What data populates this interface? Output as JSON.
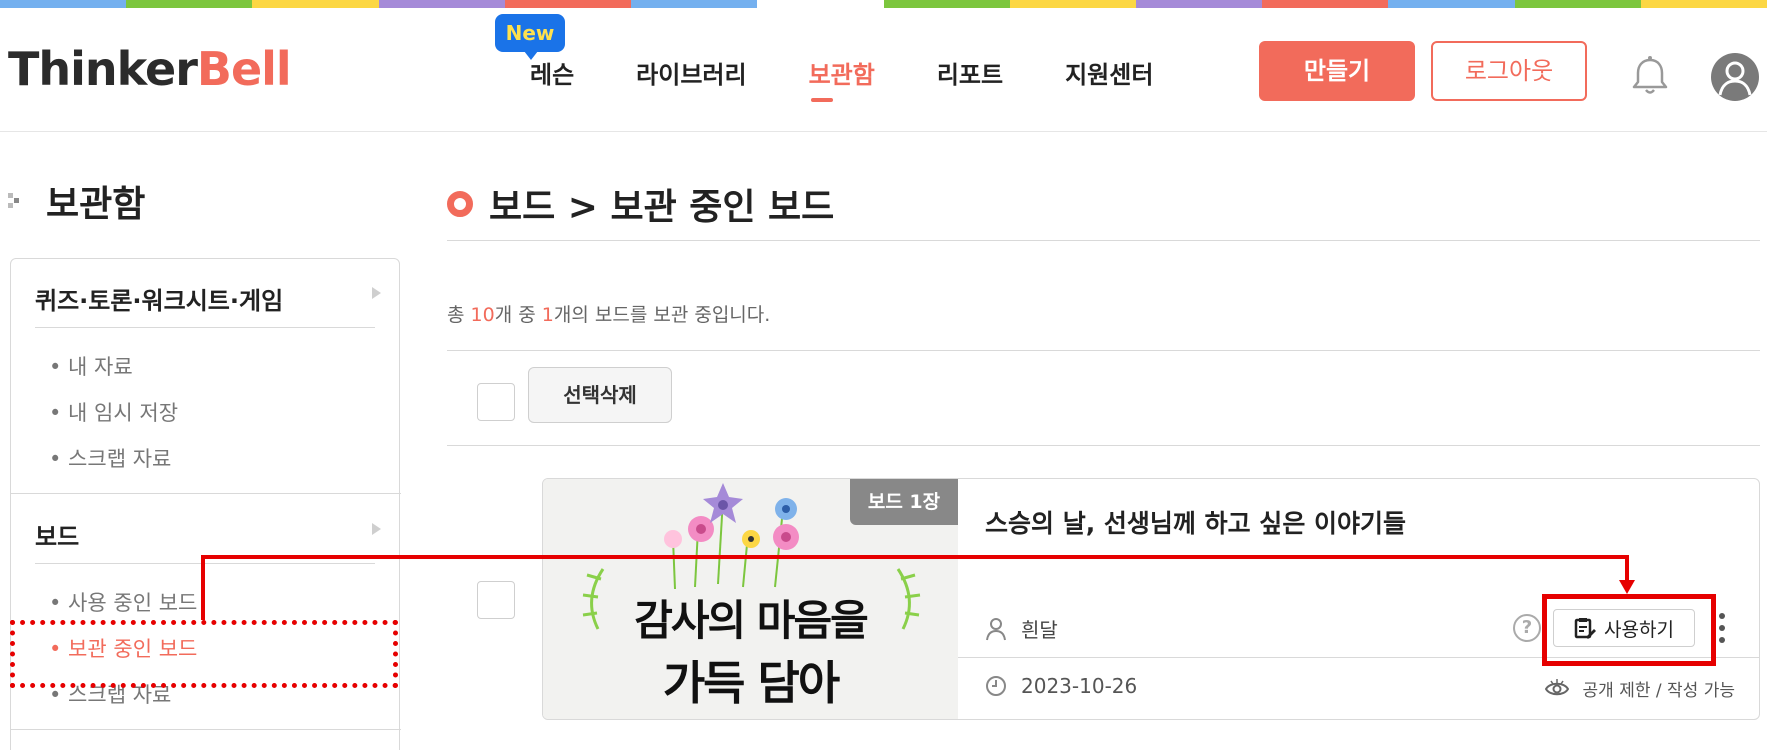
{
  "colors": {
    "accent": "#f26b5b",
    "badge_blue": "#1a73e8",
    "badge_text": "#ffe14d",
    "annotation_red": "#e60000",
    "rainbow": [
      "#74b0ef",
      "#7cc63e",
      "#fcd744",
      "#a58ad8",
      "#f26b5b",
      "#74b0ef",
      "#ffffff",
      "#7cc63e",
      "#fcd744",
      "#a58ad8",
      "#f26b5b",
      "#74b0ef",
      "#7cc63e",
      "#fcd744"
    ]
  },
  "header": {
    "logo_dark": "Thinker",
    "logo_accent": "Bell",
    "new_badge": "New",
    "nav": [
      {
        "label": "레슨"
      },
      {
        "label": "라이브러리"
      },
      {
        "label": "보관함"
      },
      {
        "label": "리포트"
      },
      {
        "label": "지원센터"
      }
    ],
    "make_button": "만들기",
    "logout_button": "로그아웃",
    "bell_icon": "bell-icon",
    "avatar_icon": "user-avatar-icon"
  },
  "sidebar": {
    "title": "보관함",
    "sections": [
      {
        "heading": "퀴즈·토론·워크시트·게임",
        "items": [
          "• 내 자료",
          "• 내 임시 저장",
          "• 스크랩 자료"
        ]
      },
      {
        "heading": "보드",
        "items": [
          "• 사용 중인 보드",
          "• 보관 중인 보드",
          "• 스크랩 자료"
        ]
      }
    ]
  },
  "main": {
    "title": "보드 > 보관 중인 보드",
    "summary": {
      "prefix": "총 ",
      "total": "10",
      "middle": "개 중 ",
      "count": "1",
      "suffix": "개의 보드를 보관 중입니다."
    },
    "delete_selected": "선택삭제",
    "card": {
      "badge": "보드 1장",
      "title": "스승의 날, 선생님께 하고 싶은 이야기들",
      "author": "흰달",
      "date": "2023-10-26",
      "visibility": "공개 제한 / 작성 가능",
      "help": "?",
      "use_button": "사용하기",
      "thumb_line1": "감사의 마음을",
      "thumb_line2": "가득 담아"
    }
  }
}
